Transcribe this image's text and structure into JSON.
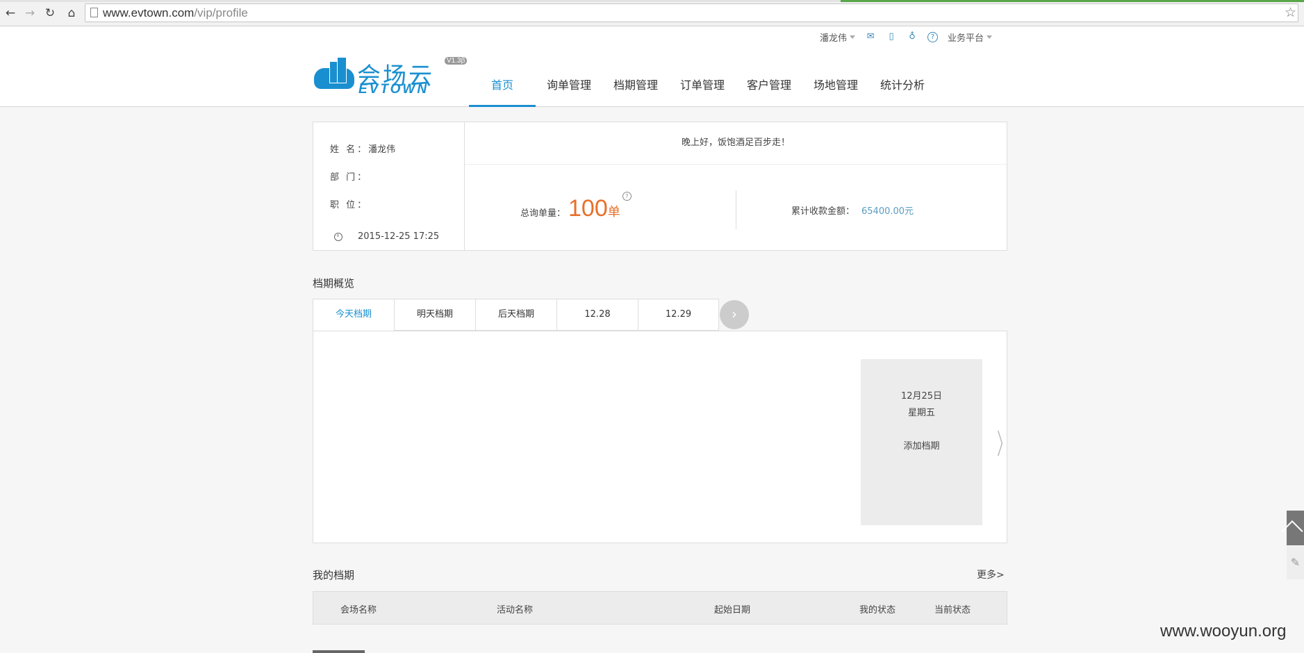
{
  "browser": {
    "back_icon": "←",
    "forward_icon": "→",
    "reload_icon": "↻",
    "home_icon": "⌂",
    "url_host": "www.evtown.com",
    "url_path": "/vip/profile",
    "star_icon": "☆"
  },
  "topbar": {
    "user_name": "潘龙伟",
    "mail_icon": "✉",
    "phone_icon": "▯",
    "wallet_icon": "♁",
    "help_icon": "?",
    "platform_label": "业务平台"
  },
  "logo": {
    "cn_text": "会场云",
    "en_text": "EVTOWN",
    "version": "V1.3β"
  },
  "nav": {
    "items": [
      "首页",
      "询单管理",
      "档期管理",
      "订单管理",
      "客户管理",
      "场地管理",
      "统计分析"
    ]
  },
  "profile": {
    "name_label": "姓 名：",
    "name_value": "潘龙伟",
    "dept_label": "部 门：",
    "title_label": "职 位：",
    "datetime": "2015-12-25 17:25",
    "greeting": "晚上好，饭饱酒足百步走！",
    "total_inquiry_label": "总询单量：",
    "total_inquiry_value": "100",
    "total_inquiry_unit": "单",
    "help_mark": "?",
    "total_income_label": "累计收款金额：",
    "total_income_value": "65400.00元"
  },
  "schedule": {
    "title": "档期概览",
    "tabs": [
      "今天档期",
      "明天档期",
      "后天档期",
      "12.28",
      "12.29"
    ],
    "next_icon": "›",
    "card_date": "12月25日",
    "card_weekday": "星期五",
    "card_action": "添加档期",
    "card_arrow": "〉"
  },
  "my_schedule": {
    "title": "我的档期",
    "more": "更多>",
    "columns": [
      "会场名称",
      "活动名称",
      "起始日期",
      "我的状态",
      "当前状态"
    ]
  },
  "side": {
    "edit_icon": "✎"
  },
  "watermark": "www.wooyun.org"
}
